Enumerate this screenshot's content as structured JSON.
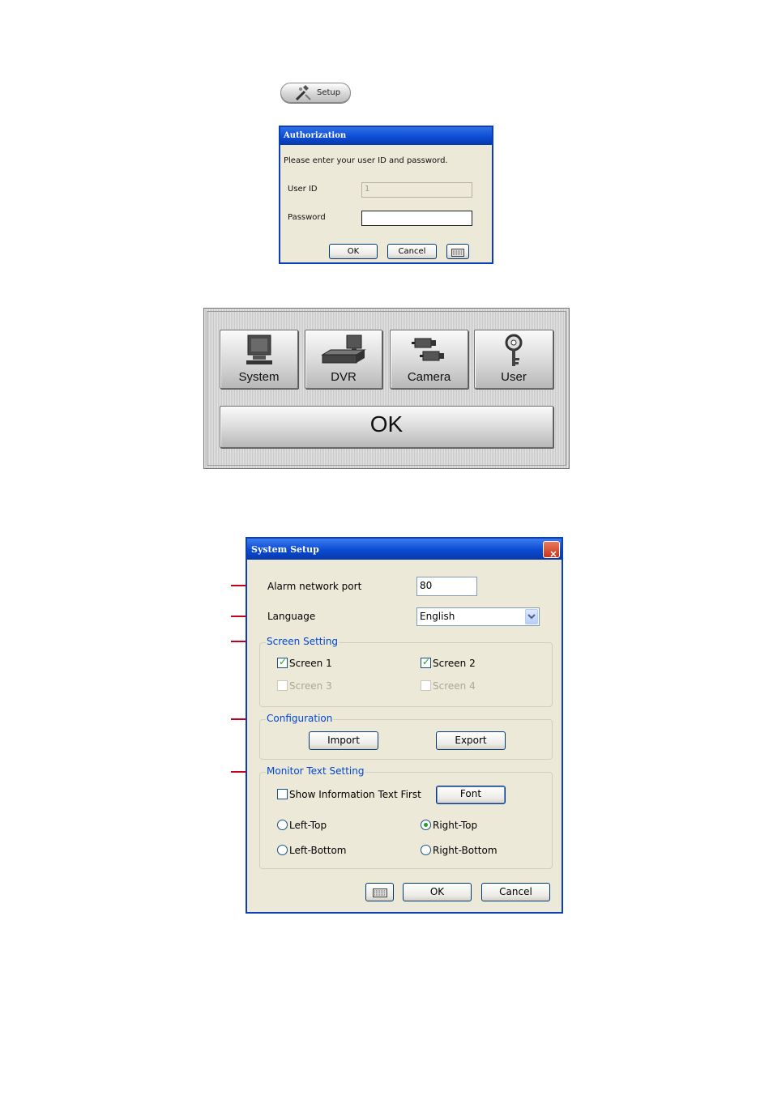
{
  "setup_button": {
    "label": "Setup",
    "icon": "tools-icon"
  },
  "auth_dialog": {
    "title": "Authorization",
    "prompt": "Please enter your user ID and password.",
    "user_id_label": "User ID",
    "user_id_value": "1",
    "password_label": "Password",
    "password_value": "",
    "ok_label": "OK",
    "cancel_label": "Cancel",
    "keyboard_icon": "keyboard-icon"
  },
  "setup_menu": {
    "items": [
      {
        "label": "System",
        "icon": "computer-icon"
      },
      {
        "label": "DVR",
        "icon": "dvr-icon"
      },
      {
        "label": "Camera",
        "icon": "camera-icon"
      },
      {
        "label": "User",
        "icon": "key-icon"
      }
    ],
    "ok_label": "OK"
  },
  "system_setup": {
    "title": "System Setup",
    "close_glyph": "✕",
    "alarm_port_label": "Alarm network port",
    "alarm_port_value": "80",
    "language_label": "Language",
    "language_value": "English",
    "screen_setting": {
      "title": "Screen Setting",
      "screens": [
        {
          "label": "Screen 1",
          "checked": true,
          "enabled": true
        },
        {
          "label": "Screen 2",
          "checked": true,
          "enabled": true
        },
        {
          "label": "Screen 3",
          "checked": false,
          "enabled": false
        },
        {
          "label": "Screen 4",
          "checked": false,
          "enabled": false
        }
      ]
    },
    "configuration": {
      "title": "Configuration",
      "import_label": "Import",
      "export_label": "Export"
    },
    "monitor_text": {
      "title": "Monitor  Text Setting",
      "show_info_label": "Show Information Text First",
      "show_info_checked": false,
      "font_label": "Font",
      "positions": [
        {
          "label": "Left-Top",
          "selected": false
        },
        {
          "label": "Right-Top",
          "selected": true
        },
        {
          "label": "Left-Bottom",
          "selected": false
        },
        {
          "label": "Right-Bottom",
          "selected": false
        }
      ]
    },
    "ok_label": "OK",
    "cancel_label": "Cancel",
    "callout_color": "#c8001e"
  }
}
